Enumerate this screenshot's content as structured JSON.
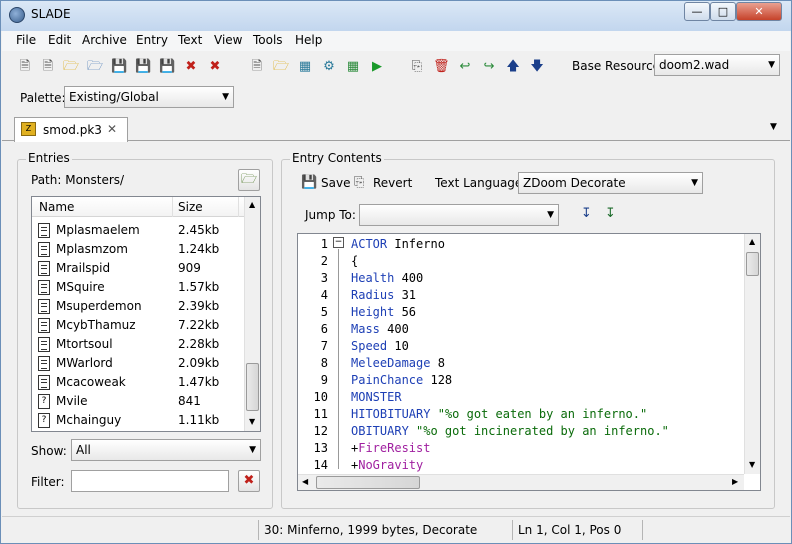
{
  "window": {
    "title": "SLADE"
  },
  "menu": [
    "File",
    "Edit",
    "Archive",
    "Entry",
    "Text",
    "View",
    "Tools",
    "Help"
  ],
  "toolbar": {
    "base_resource_label": "Base Resource:",
    "base_resource_value": "doom2.wad",
    "palette_label": "Palette:",
    "palette_value": "Existing/Global"
  },
  "tab": {
    "label": "smod.pk3"
  },
  "entries_panel": {
    "title": "Entries",
    "path_label": "Path: Monsters/",
    "columns": {
      "name": "Name",
      "size": "Size"
    },
    "rows": [
      {
        "name": "Mplasmaelem",
        "size": "2.45kb",
        "icon": "text-file-icon"
      },
      {
        "name": "Mplasmzom",
        "size": "1.24kb",
        "icon": "text-file-icon"
      },
      {
        "name": "Mrailspid",
        "size": "909",
        "icon": "text-file-icon"
      },
      {
        "name": "MSquire",
        "size": "1.57kb",
        "icon": "text-file-icon"
      },
      {
        "name": "Msuperdemon",
        "size": "2.39kb",
        "icon": "text-file-icon"
      },
      {
        "name": "McybThamuz",
        "size": "7.22kb",
        "icon": "text-file-icon"
      },
      {
        "name": "Mtortsoul",
        "size": "2.28kb",
        "icon": "text-file-icon"
      },
      {
        "name": "MWarlord",
        "size": "2.09kb",
        "icon": "text-file-icon"
      },
      {
        "name": "Mcacoweak",
        "size": "1.47kb",
        "icon": "text-file-icon"
      },
      {
        "name": "Mvile",
        "size": "841",
        "icon": "unknown-file-icon"
      },
      {
        "name": "Mchainguy",
        "size": "1.11kb",
        "icon": "unknown-file-icon"
      }
    ],
    "show_label": "Show:",
    "show_value": "All",
    "filter_label": "Filter:",
    "filter_value": ""
  },
  "entry_contents": {
    "title": "Entry Contents",
    "save_label": "Save",
    "revert_label": "Revert",
    "text_language_label": "Text Language:",
    "text_language_value": "ZDoom Decorate",
    "jump_to_label": "Jump To:",
    "jump_to_value": "",
    "lines": [
      {
        "n": "1",
        "parts": [
          [
            "kw",
            "ACTOR"
          ],
          [
            "",
            " Inferno"
          ]
        ]
      },
      {
        "n": "2",
        "parts": [
          [
            "",
            "{"
          ]
        ]
      },
      {
        "n": "3",
        "parts": [
          [
            "kw",
            "Health"
          ],
          [
            "",
            " 400"
          ]
        ]
      },
      {
        "n": "4",
        "parts": [
          [
            "kw",
            "Radius"
          ],
          [
            "",
            " 31"
          ]
        ]
      },
      {
        "n": "5",
        "parts": [
          [
            "kw",
            "Height"
          ],
          [
            "",
            " 56"
          ]
        ]
      },
      {
        "n": "6",
        "parts": [
          [
            "kw",
            "Mass"
          ],
          [
            "",
            " 400"
          ]
        ]
      },
      {
        "n": "7",
        "parts": [
          [
            "kw",
            "Speed"
          ],
          [
            "",
            " 10"
          ]
        ]
      },
      {
        "n": "8",
        "parts": [
          [
            "kw",
            "MeleeDamage"
          ],
          [
            "",
            " 8"
          ]
        ]
      },
      {
        "n": "9",
        "parts": [
          [
            "kw",
            "PainChance"
          ],
          [
            "",
            " 128"
          ]
        ]
      },
      {
        "n": "10",
        "parts": [
          [
            "kw",
            "MONSTER"
          ]
        ]
      },
      {
        "n": "11",
        "parts": [
          [
            "kw",
            "HITOBITUARY"
          ],
          [
            "",
            " "
          ],
          [
            "str",
            "\"%o got eaten by an inferno.\""
          ]
        ]
      },
      {
        "n": "12",
        "parts": [
          [
            "kw",
            "OBITUARY"
          ],
          [
            "",
            " "
          ],
          [
            "str",
            "\"%o got incinerated by an inferno.\""
          ]
        ]
      },
      {
        "n": "13",
        "parts": [
          [
            "",
            "+"
          ],
          [
            "flag",
            "FireResist"
          ]
        ]
      },
      {
        "n": "14",
        "parts": [
          [
            "",
            "+"
          ],
          [
            "flag",
            "NoGravity"
          ]
        ]
      }
    ]
  },
  "status": {
    "entry_info": "30: Minferno, 1999 bytes, Decorate",
    "cursor": "Ln 1, Col 1, Pos 0"
  }
}
